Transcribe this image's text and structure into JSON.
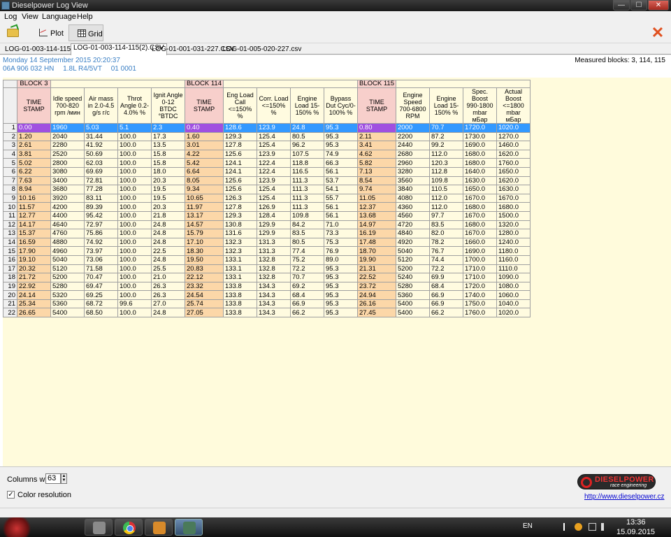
{
  "window": {
    "title": "Dieselpower Log View",
    "min_glyph": "—",
    "max_glyph": "☐",
    "close_glyph": "✕"
  },
  "menu": [
    "Log",
    "View",
    "Language",
    "Help"
  ],
  "toolbar": {
    "plot_label": "Plot",
    "grid_label": "Grid",
    "close_glyph": "✕"
  },
  "tabs": [
    {
      "label": "LOG-01-003-114-115.csv",
      "active": false
    },
    {
      "label": "LOG-01-003-114-115(2).CSV",
      "active": true
    },
    {
      "label": "LOG-01-001-031-227.CSV",
      "active": false
    },
    {
      "label": "LOG-01-005-020-227.csv",
      "active": false
    }
  ],
  "info": {
    "date": "Monday 14 September 2015 20:20:37",
    "ecu_part": "06A 906 032 HN",
    "engine": "1.8L R4/5VT",
    "code": "01 0001",
    "measured_blocks": "Measured blocks: 3, 114, 115"
  },
  "grid": {
    "blocks": [
      "BLOCK 3",
      "BLOCK 114",
      "BLOCK 115"
    ],
    "headers": [
      "TIME STAMP",
      "Idle speed 700-820 rpm /мин",
      "Air mass in 2.0-4.5 g/s г/с",
      "Throt Angle 0.2-4.0% %",
      "Ignit Angle 0-12 BTDC °BTDC",
      "TIME STAMP",
      "Eng Load Call <=150% %",
      "Corr. Load <=150% %",
      "Engine Load 15-150% %",
      "Bypass Dut Cyc/0-100% %",
      "TIME STAMP",
      "Engine Speed 700-6800 RPM",
      "Engine Load 15-150% %",
      "Spec. Boost 990-1800 mbar мБар",
      "Actual Boost <=1800 mbar мБар"
    ],
    "rows": [
      [
        "0.00",
        "1960",
        "5.03",
        "5.1",
        "2.3",
        "0.40",
        "128.6",
        "123.9",
        "24.8",
        "95.3",
        "0.80",
        "2000",
        "70.7",
        "1720.0",
        "1020.0"
      ],
      [
        "1.20",
        "2040",
        "31.44",
        "100.0",
        "17.3",
        "1.60",
        "129.3",
        "125.4",
        "80.5",
        "95.3",
        "2.11",
        "2200",
        "87.2",
        "1730.0",
        "1270.0"
      ],
      [
        "2.61",
        "2280",
        "41.92",
        "100.0",
        "13.5",
        "3.01",
        "127.8",
        "125.4",
        "96.2",
        "95.3",
        "3.41",
        "2440",
        "99.2",
        "1690.0",
        "1460.0"
      ],
      [
        "3.81",
        "2520",
        "50.69",
        "100.0",
        "15.8",
        "4.22",
        "125.6",
        "123.9",
        "107.5",
        "74.9",
        "4.62",
        "2680",
        "112.0",
        "1680.0",
        "1620.0"
      ],
      [
        "5.02",
        "2800",
        "62.03",
        "100.0",
        "15.8",
        "5.42",
        "124.1",
        "122.4",
        "118.8",
        "66.3",
        "5.82",
        "2960",
        "120.3",
        "1680.0",
        "1760.0"
      ],
      [
        "6.22",
        "3080",
        "69.69",
        "100.0",
        "18.0",
        "6.64",
        "124.1",
        "122.4",
        "116.5",
        "56.1",
        "7.13",
        "3280",
        "112.8",
        "1640.0",
        "1650.0"
      ],
      [
        "7.63",
        "3400",
        "72.81",
        "100.0",
        "20.3",
        "8.05",
        "125.6",
        "123.9",
        "111.3",
        "53.7",
        "8.54",
        "3560",
        "109.8",
        "1630.0",
        "1620.0"
      ],
      [
        "8.94",
        "3680",
        "77.28",
        "100.0",
        "19.5",
        "9.34",
        "125.6",
        "125.4",
        "111.3",
        "54.1",
        "9.74",
        "3840",
        "110.5",
        "1650.0",
        "1630.0"
      ],
      [
        "10.16",
        "3920",
        "83.11",
        "100.0",
        "19.5",
        "10.65",
        "126.3",
        "125.4",
        "111.3",
        "55.7",
        "11.05",
        "4080",
        "112.0",
        "1670.0",
        "1670.0"
      ],
      [
        "11.57",
        "4200",
        "89.39",
        "100.0",
        "20.3",
        "11.97",
        "127.8",
        "126.9",
        "111.3",
        "56.1",
        "12.37",
        "4360",
        "112.0",
        "1680.0",
        "1680.0"
      ],
      [
        "12.77",
        "4400",
        "95.42",
        "100.0",
        "21.8",
        "13.17",
        "129.3",
        "128.4",
        "109.8",
        "56.1",
        "13.68",
        "4560",
        "97.7",
        "1670.0",
        "1500.0"
      ],
      [
        "14.17",
        "4640",
        "72.97",
        "100.0",
        "24.8",
        "14.57",
        "130.8",
        "129.9",
        "84.2",
        "71.0",
        "14.97",
        "4720",
        "83.5",
        "1680.0",
        "1320.0"
      ],
      [
        "15.37",
        "4760",
        "75.86",
        "100.0",
        "24.8",
        "15.79",
        "131.6",
        "129.9",
        "83.5",
        "73.3",
        "16.19",
        "4840",
        "82.0",
        "1670.0",
        "1280.0"
      ],
      [
        "16.59",
        "4880",
        "74.92",
        "100.0",
        "24.8",
        "17.10",
        "132.3",
        "131.3",
        "80.5",
        "75.3",
        "17.48",
        "4920",
        "78.2",
        "1660.0",
        "1240.0"
      ],
      [
        "17.90",
        "4960",
        "73.97",
        "100.0",
        "22.5",
        "18.30",
        "132.3",
        "131.3",
        "77.4",
        "76.9",
        "18.70",
        "5040",
        "76.7",
        "1690.0",
        "1180.0"
      ],
      [
        "19.10",
        "5040",
        "73.06",
        "100.0",
        "24.8",
        "19.50",
        "133.1",
        "132.8",
        "75.2",
        "89.0",
        "19.90",
        "5120",
        "74.4",
        "1700.0",
        "1160.0"
      ],
      [
        "20.32",
        "5120",
        "71.58",
        "100.0",
        "25.5",
        "20.83",
        "133.1",
        "132.8",
        "72.2",
        "95.3",
        "21.31",
        "5200",
        "72.2",
        "1710.0",
        "1110.0"
      ],
      [
        "21.72",
        "5200",
        "70.47",
        "100.0",
        "21.0",
        "22.12",
        "133.1",
        "132.8",
        "70.7",
        "95.3",
        "22.52",
        "5240",
        "69.9",
        "1710.0",
        "1090.0"
      ],
      [
        "22.92",
        "5280",
        "69.47",
        "100.0",
        "26.3",
        "23.32",
        "133.8",
        "134.3",
        "69.2",
        "95.3",
        "23.72",
        "5280",
        "68.4",
        "1720.0",
        "1080.0"
      ],
      [
        "24.14",
        "5320",
        "69.25",
        "100.0",
        "26.3",
        "24.54",
        "133.8",
        "134.3",
        "68.4",
        "95.3",
        "24.94",
        "5360",
        "66.9",
        "1740.0",
        "1060.0"
      ],
      [
        "25.34",
        "5360",
        "68.72",
        "99.6",
        "27.0",
        "25.74",
        "133.8",
        "134.3",
        "66.9",
        "95.3",
        "26.16",
        "5400",
        "66.9",
        "1750.0",
        "1040.0"
      ],
      [
        "26.65",
        "5400",
        "68.50",
        "100.0",
        "24.8",
        "27.05",
        "133.8",
        "134.3",
        "66.2",
        "95.3",
        "27.45",
        "5400",
        "66.2",
        "1760.0",
        "1020.0"
      ]
    ]
  },
  "bottom": {
    "columns_width_label": "Columns width:",
    "columns_width_value": "63",
    "spin_up": "▲",
    "spin_down": "▼",
    "color_resolution_label": "Color resolution",
    "color_resolution_checked": "✓",
    "logo_title": "DIESELPOWER",
    "logo_sub": "race engineering",
    "url": "http://www.dieselpower.cz"
  },
  "taskbar": {
    "apps": [
      "app-1",
      "chrome",
      "app-3",
      "dieselpower-logview"
    ],
    "lang": "EN",
    "time": "13:36",
    "date": "15.09.2015"
  }
}
